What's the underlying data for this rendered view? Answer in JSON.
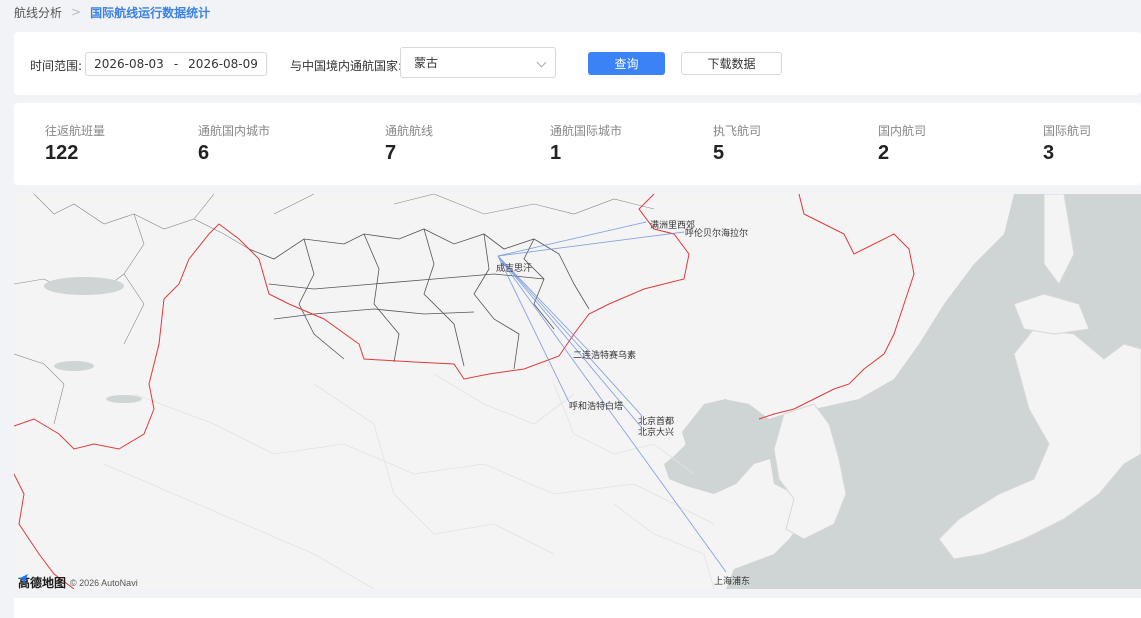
{
  "breadcrumb": {
    "first": "航线分析",
    "separator": ">",
    "current": "国际航线运行数据统计"
  },
  "filters": {
    "time_range_label": "时间范围:",
    "date_start": "2026-08-03",
    "date_separator": "-",
    "date_end": "2026-08-09",
    "country_label": "与中国境内通航国家:",
    "country_value": "蒙古",
    "query_button": "查询",
    "download_button": "下载数据"
  },
  "stats": [
    {
      "label": "往返航班量",
      "value": "122"
    },
    {
      "label": "通航国内城市",
      "value": "6"
    },
    {
      "label": "通航航线",
      "value": "7"
    },
    {
      "label": "通航国际城市",
      "value": "1"
    },
    {
      "label": "执飞航司",
      "value": "5"
    },
    {
      "label": "国内航司",
      "value": "2"
    },
    {
      "label": "国际航司",
      "value": "3"
    }
  ],
  "map": {
    "hub": "成吉思汗",
    "cities": [
      "满洲里西郊",
      "呼伦贝尔海拉尔",
      "二连浩特赛乌素",
      "呼和浩特白塔",
      "北京首都",
      "北京大兴",
      "上海浦东"
    ],
    "logo": "高德地图",
    "copyright": "© 2026 AutoNavi",
    "colors": {
      "land": "#f4f4f4",
      "sea": "#cfd4d4",
      "route": "#6b8fe0",
      "border": "#e03a3a"
    }
  }
}
